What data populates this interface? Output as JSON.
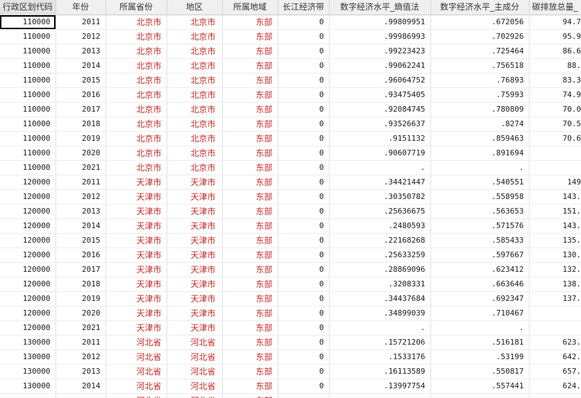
{
  "columns": [
    {
      "label": "行政区划代码"
    },
    {
      "label": "年份"
    },
    {
      "label": "所属省份"
    },
    {
      "label": "地区"
    },
    {
      "label": "所属地域"
    },
    {
      "label": "长江经济带"
    },
    {
      "label": "数字经济水平_熵值法"
    },
    {
      "label": "数字经济水平_主成分"
    },
    {
      "label": "碳排放总量_"
    }
  ],
  "rows": [
    [
      "110000",
      "2011",
      "北京市",
      "北京市",
      "东部",
      "0",
      ".99809951",
      ".672056",
      "94.7"
    ],
    [
      "110000",
      "2012",
      "北京市",
      "北京市",
      "东部",
      "0",
      ".99986993",
      ".702926",
      "95.9"
    ],
    [
      "110000",
      "2013",
      "北京市",
      "北京市",
      "东部",
      "0",
      ".99223423",
      ".725464",
      "86.6"
    ],
    [
      "110000",
      "2014",
      "北京市",
      "北京市",
      "东部",
      "0",
      ".99062241",
      ".756518",
      "88."
    ],
    [
      "110000",
      "2015",
      "北京市",
      "北京市",
      "东部",
      "0",
      ".96064752",
      ".76893",
      "83.3"
    ],
    [
      "110000",
      "2016",
      "北京市",
      "北京市",
      "东部",
      "0",
      ".93475405",
      ".75993",
      "74.9"
    ],
    [
      "110000",
      "2017",
      "北京市",
      "北京市",
      "东部",
      "0",
      ".92084745",
      ".780809",
      "70.0"
    ],
    [
      "110000",
      "2018",
      "北京市",
      "北京市",
      "东部",
      "0",
      ".93526637",
      ".8274",
      "70.5"
    ],
    [
      "110000",
      "2019",
      "北京市",
      "北京市",
      "东部",
      "0",
      ".9151132",
      ".859463",
      "70.6"
    ],
    [
      "110000",
      "2020",
      "北京市",
      "北京市",
      "东部",
      "0",
      ".90607719",
      ".891694",
      ""
    ],
    [
      "110000",
      "2021",
      "北京市",
      "北京市",
      "东部",
      "0",
      ".",
      ".",
      ""
    ],
    [
      "120000",
      "2011",
      "天津市",
      "天津市",
      "东部",
      "0",
      ".34421447",
      ".540551",
      "149"
    ],
    [
      "120000",
      "2012",
      "天津市",
      "天津市",
      "东部",
      "0",
      ".30350782",
      ".558958",
      "143."
    ],
    [
      "120000",
      "2013",
      "天津市",
      "天津市",
      "东部",
      "0",
      ".25636675",
      ".563653",
      "151."
    ],
    [
      "120000",
      "2014",
      "天津市",
      "天津市",
      "东部",
      "0",
      ".2480593",
      ".571576",
      "143."
    ],
    [
      "120000",
      "2015",
      "天津市",
      "天津市",
      "东部",
      "0",
      ".22168268",
      ".585433",
      "135."
    ],
    [
      "120000",
      "2016",
      "天津市",
      "天津市",
      "东部",
      "0",
      ".25633259",
      ".597667",
      "130."
    ],
    [
      "120000",
      "2017",
      "天津市",
      "天津市",
      "东部",
      "0",
      ".28869096",
      ".623412",
      "132."
    ],
    [
      "120000",
      "2018",
      "天津市",
      "天津市",
      "东部",
      "0",
      ".3208331",
      ".663646",
      "138."
    ],
    [
      "120000",
      "2019",
      "天津市",
      "天津市",
      "东部",
      "0",
      ".34437684",
      ".692347",
      "137."
    ],
    [
      "120000",
      "2020",
      "天津市",
      "天津市",
      "东部",
      "0",
      ".34899039",
      ".710467",
      ""
    ],
    [
      "120000",
      "2021",
      "天津市",
      "天津市",
      "东部",
      "0",
      ".",
      ".",
      ""
    ],
    [
      "130000",
      "2011",
      "河北省",
      "河北省",
      "东部",
      "0",
      ".15721206",
      ".516181",
      "623."
    ],
    [
      "130000",
      "2012",
      "河北省",
      "河北省",
      "东部",
      "0",
      ".1533176",
      ".53199",
      "642."
    ],
    [
      "130000",
      "2013",
      "河北省",
      "河北省",
      "东部",
      "0",
      ".16113589",
      ".550817",
      "657."
    ],
    [
      "130000",
      "2014",
      "河北省",
      "河北省",
      "东部",
      "0",
      ".13997754",
      ".557441",
      "624."
    ],
    [
      "",
      "",
      "河北省",
      "河北省",
      "东部",
      "",
      "",
      "",
      ""
    ]
  ],
  "selected_cell": {
    "row": 0,
    "column": 0
  },
  "colors": {
    "string_text": "#c62828",
    "numeric_text": "#1a1a1a",
    "header_text": "#333333",
    "header_background": "#f0f0f0",
    "selected_header_background": "#e3e3e3",
    "grid_line": "#e1e1e1",
    "selection_border": "#000000"
  }
}
